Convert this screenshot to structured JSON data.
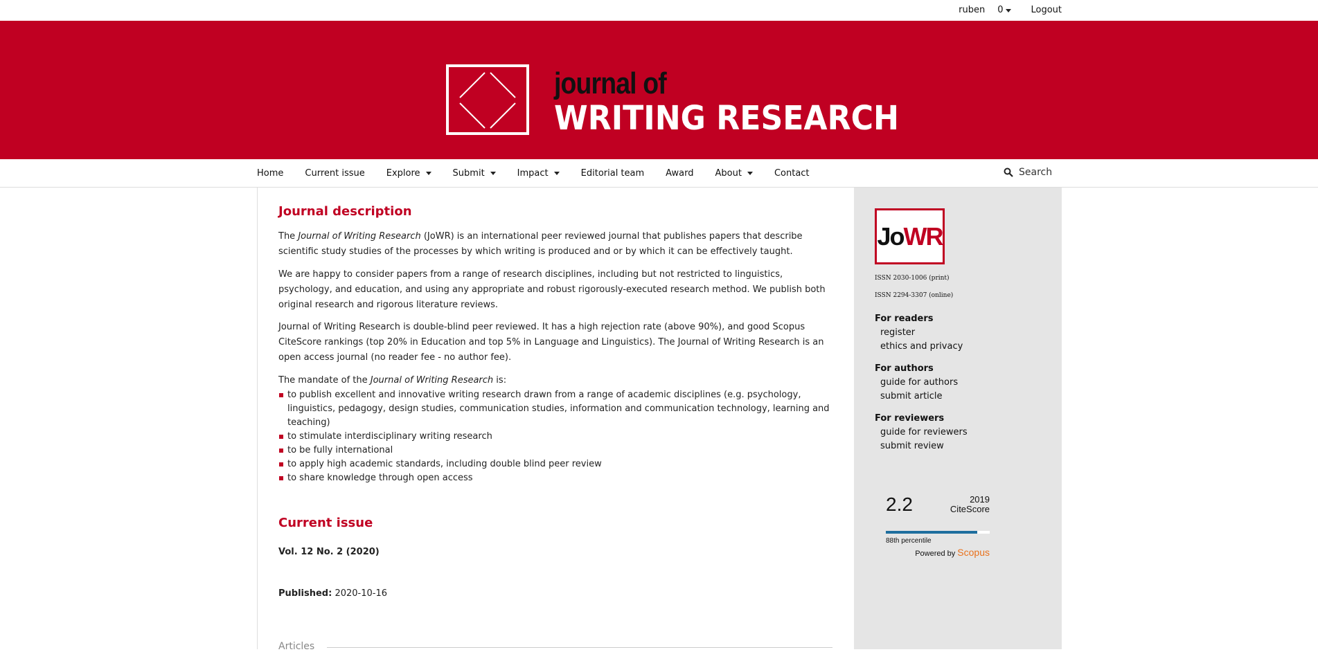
{
  "userbar": {
    "username": "ruben",
    "notifications": "0",
    "logout": "Logout"
  },
  "header": {
    "logo_line1": "journal of",
    "logo_line2": "WRITING RESEARCH",
    "brand_color": "#c00022"
  },
  "nav": {
    "items": [
      {
        "label": "Home",
        "dropdown": false
      },
      {
        "label": "Current issue",
        "dropdown": false
      },
      {
        "label": "Explore",
        "dropdown": true
      },
      {
        "label": "Submit",
        "dropdown": true
      },
      {
        "label": "Impact",
        "dropdown": true
      },
      {
        "label": "Editorial team",
        "dropdown": false
      },
      {
        "label": "Award",
        "dropdown": false
      },
      {
        "label": "About",
        "dropdown": true
      },
      {
        "label": "Contact",
        "dropdown": false
      }
    ],
    "search_label": "Search",
    "search_icon": "search-icon"
  },
  "main": {
    "description_title": "Journal description",
    "p1_before": "The ",
    "p1_italic": "Journal of Writing Research",
    "p1_after": " (JoWR) is an international peer reviewed journal that publishes papers that describe scientific study studies of the processes by which writing is produced and or by which it can be effectively taught.",
    "p2": "We are happy to consider papers from a range of research disciplines, including but not restricted to linguistics, psychology, and education, and using any appropriate and robust rigorously-executed research method. We publish both original research and rigorous literature reviews.",
    "p3": "Journal of Writing Research is double-blind peer reviewed. It has a high rejection rate (above 90%), and good Scopus CiteScore rankings (top 20% in Education and top 5% in Language and Linguistics). The Journal of Writing Research is an open access journal (no reader fee - no author fee).",
    "p4_before": "The mandate of the ",
    "p4_italic": "Journal of Writing Research",
    "p4_after": " is:",
    "mandate": [
      "to publish excellent and innovative writing research drawn from a range of academic disciplines (e.g. psychology, linguistics, pedagogy, design studies, communication studies, information and communication technology, learning and teaching)",
      "to stimulate interdisciplinary writing research",
      "to be fully international",
      "to apply high academic standards, including double blind peer review",
      "to share knowledge through open access"
    ],
    "current_issue_title": "Current issue",
    "volume": "Vol. 12 No. 2 (2020)",
    "published_label": "Published:",
    "published_date": "2020-10-16",
    "articles_label": "Articles"
  },
  "sidebar": {
    "logo_j": "Jo",
    "logo_wr": "WR",
    "issn_print": "ISSN 2030-1006 (print)",
    "issn_online": "ISSN 2294-3307 (online)",
    "readers": {
      "heading": "For readers",
      "links": [
        "register",
        "ethics and privacy"
      ]
    },
    "authors": {
      "heading": "For authors",
      "links": [
        "guide for authors",
        "submit article"
      ]
    },
    "reviewers": {
      "heading": "For reviewers",
      "links": [
        "guide for reviewers",
        "submit review"
      ]
    },
    "citescore": {
      "value": "2.2",
      "year": "2019",
      "label": "CiteScore",
      "percentile_text": "88th percentile",
      "percentile": 88,
      "powered_by": "Powered by",
      "scopus": "Scopus"
    }
  }
}
